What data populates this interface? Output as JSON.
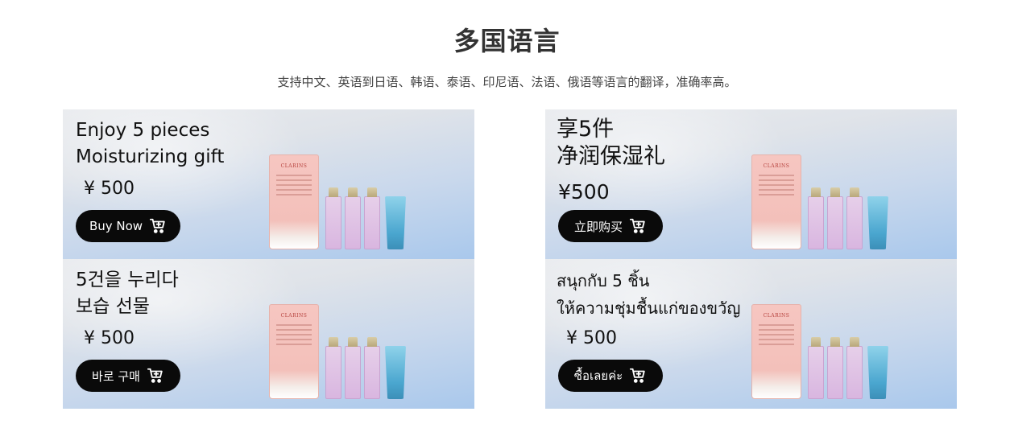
{
  "page": {
    "title": "多国语言",
    "subtitle": "支持中文、英语到日语、韩语、泰语、印尼语、法语、俄语等语言的翻译，准确率高。"
  },
  "banners": [
    {
      "line1": "Enjoy 5 pieces",
      "line2": "Moisturizing gift",
      "price": "¥ 500",
      "button": "Buy Now",
      "product_brand": "CLARINS"
    },
    {
      "line1": "享5件",
      "line2": "净润保湿礼",
      "price": "¥500",
      "button": "立即购买",
      "product_brand": "CLARINS"
    },
    {
      "line1": "5건을 누리다",
      "line2": "보습 선물",
      "price": "¥ 500",
      "button": "바로 구매",
      "product_brand": "CLARINS"
    },
    {
      "line1": "สนุกกับ 5 ชิ้น",
      "line2": "ให้ความชุ่มชื้นแก่ของขวัญ",
      "price": "¥ 500",
      "button": "ซื้อเลยค่ะ",
      "product_brand": "CLARINS"
    }
  ],
  "icons": {
    "button_icon": "shopping-cart-icon"
  }
}
